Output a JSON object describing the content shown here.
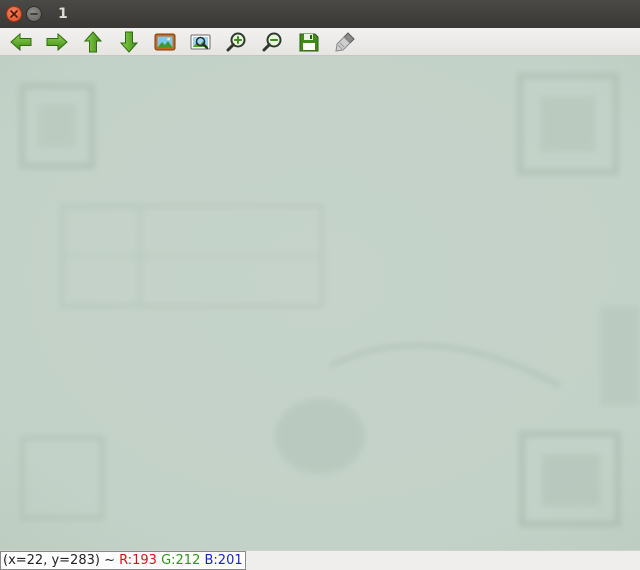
{
  "window": {
    "title": "1",
    "buttons": [
      "close",
      "minimize"
    ]
  },
  "toolbar": {
    "buttons": [
      {
        "name": "pan-left",
        "icon": "arrow-left-icon"
      },
      {
        "name": "pan-right",
        "icon": "arrow-right-icon"
      },
      {
        "name": "pan-up",
        "icon": "arrow-up-icon"
      },
      {
        "name": "pan-down",
        "icon": "arrow-down-icon"
      },
      {
        "name": "zoom-to-original",
        "icon": "image-icon"
      },
      {
        "name": "zoom-fit",
        "icon": "zoom-picture-icon"
      },
      {
        "name": "zoom-in",
        "icon": "zoom-in-icon"
      },
      {
        "name": "zoom-out",
        "icon": "zoom-out-icon"
      },
      {
        "name": "save",
        "icon": "floppy-disk-icon"
      },
      {
        "name": "properties",
        "icon": "brush-icon"
      }
    ]
  },
  "status": {
    "coords": "(x=22, y=283) ~",
    "r": "R:193",
    "g": "G:212",
    "b": "B:201"
  },
  "colors": {
    "titlebar": "#3c3b37",
    "canvas": "#c8d6cc",
    "arrow_green": "#4a9e1c",
    "r_text": "#e01010",
    "g_text": "#2a9a10",
    "b_text": "#1424d8"
  }
}
